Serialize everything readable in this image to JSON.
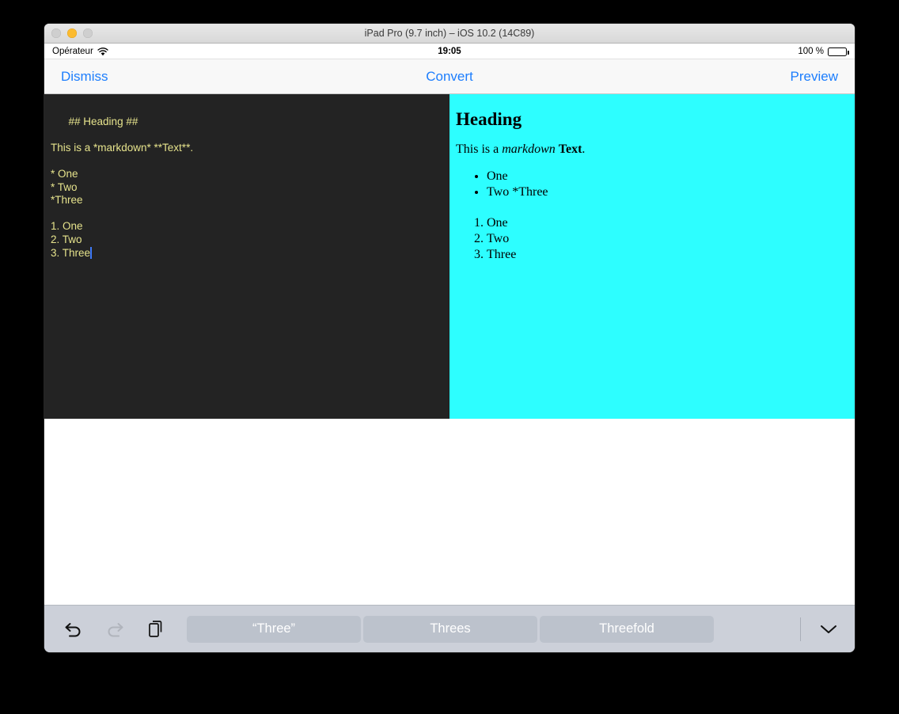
{
  "window": {
    "title": "iPad Pro (9.7 inch) – iOS 10.2 (14C89)",
    "traffic_lights": [
      {
        "name": "close",
        "color": "#cfcfcf",
        "active": false
      },
      {
        "name": "minimize",
        "color": "#fcbb2f",
        "active": true
      },
      {
        "name": "zoom",
        "color": "#cfcfcf",
        "active": false
      }
    ]
  },
  "statusbar": {
    "carrier": "Opérateur",
    "wifi_icon": "wifi-icon",
    "time": "19:05",
    "battery_percent": "100 %",
    "battery_icon": "battery-full-icon"
  },
  "navbar": {
    "dismiss_label": "Dismiss",
    "convert_label": "Convert",
    "preview_label": "Preview",
    "tint_color": "#1d7efd"
  },
  "editor": {
    "background": "#232323",
    "text_color": "#e6e38c",
    "caret_color": "#3e79f7",
    "lines": [
      "## Heading ##",
      "",
      "This is a *markdown* **Text**.",
      "",
      "* One",
      "* Two",
      "*Three",
      "",
      "1. One",
      "2. Two"
    ],
    "last_line": "3. Three"
  },
  "preview": {
    "background": "#2dfeff",
    "heading": "Heading",
    "paragraph": {
      "prefix": "This is a ",
      "italic": "markdown",
      "space": " ",
      "bold": "Text",
      "suffix": "."
    },
    "bullets": [
      "One",
      "Two *Three"
    ],
    "numbered": [
      "One",
      "Two",
      "Three"
    ]
  },
  "accessory": {
    "background": "#ccd0d9",
    "undo_icon": "undo-icon",
    "redo_icon": "redo-icon",
    "paste_icon": "paste-icon",
    "undo_enabled": true,
    "redo_enabled": false,
    "suggestions": [
      "“Three”",
      "Threes",
      "Threefold"
    ],
    "dismiss_keyboard_icon": "chevron-down-icon"
  }
}
